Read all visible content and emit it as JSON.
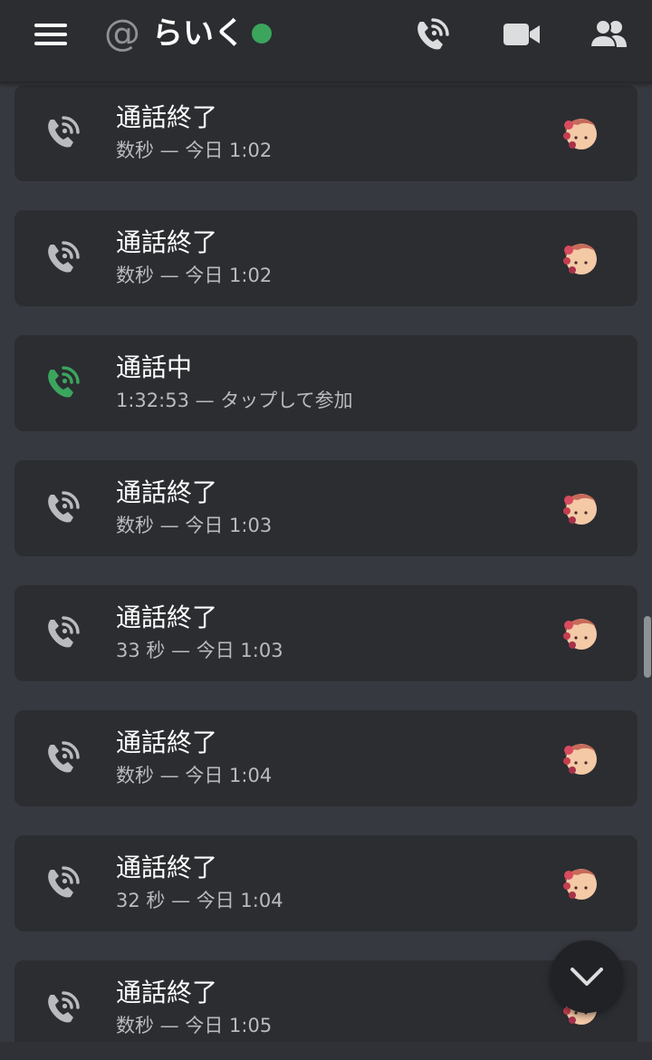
{
  "header": {
    "at_symbol": "@",
    "username": "らいく",
    "status": "online",
    "status_color": "#3ba55d",
    "actions": [
      "voice-call-icon",
      "video-call-icon",
      "members-icon"
    ]
  },
  "calls": [
    {
      "title": "通話終了",
      "subtitle": "数秒 — 今日 1:02",
      "state": "ended",
      "icon": "phone-ended-icon"
    },
    {
      "title": "通話終了",
      "subtitle": "数秒 — 今日 1:02",
      "state": "ended",
      "icon": "phone-ended-icon"
    },
    {
      "title": "通話中",
      "subtitle": "1:32:53 — タップして参加",
      "state": "ongoing",
      "icon": "phone-active-icon"
    },
    {
      "title": "通話終了",
      "subtitle": "数秒 — 今日 1:03",
      "state": "ended",
      "icon": "phone-ended-icon"
    },
    {
      "title": "通話終了",
      "subtitle": "33 秒 — 今日 1:03",
      "state": "ended",
      "icon": "phone-ended-icon"
    },
    {
      "title": "通話終了",
      "subtitle": "数秒 — 今日 1:04",
      "state": "ended",
      "icon": "phone-ended-icon"
    },
    {
      "title": "通話終了",
      "subtitle": "32 秒 — 今日 1:04",
      "state": "ended",
      "icon": "phone-ended-icon"
    },
    {
      "title": "通話終了",
      "subtitle": "数秒 — 今日 1:05",
      "state": "ended",
      "icon": "phone-ended-icon"
    }
  ],
  "colors": {
    "background": "#36393f",
    "card": "#2b2d31",
    "active_call": "#3ba55d",
    "ended_call": "#b9bbbe"
  },
  "jump_button_icon": "chevron-down-icon"
}
